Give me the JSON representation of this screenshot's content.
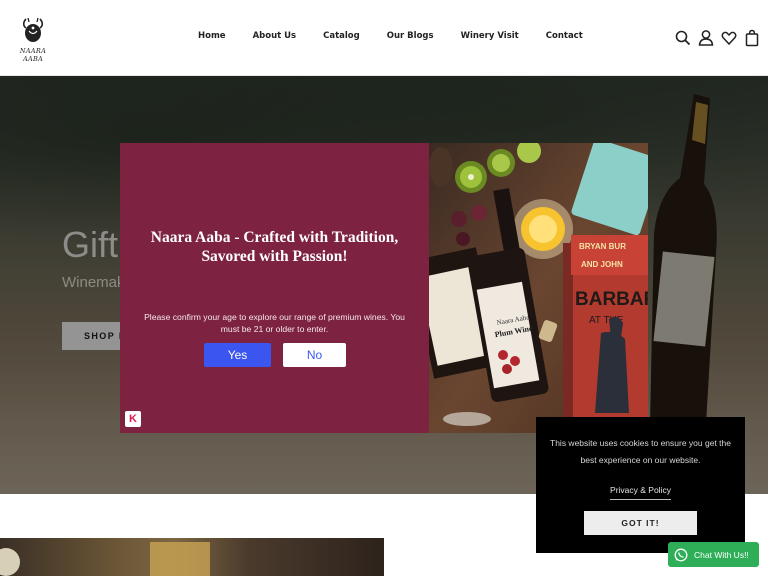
{
  "brand": {
    "name": "NAARA AABA"
  },
  "nav": {
    "items": [
      {
        "label": "Home"
      },
      {
        "label": "About Us"
      },
      {
        "label": "Catalog"
      },
      {
        "label": "Our Blogs"
      },
      {
        "label": "Winery Visit"
      },
      {
        "label": "Contact"
      }
    ]
  },
  "header_icons": [
    "search-icon",
    "account-icon",
    "wishlist-heart-icon",
    "cart-bag-icon"
  ],
  "hero": {
    "title": "Gift",
    "subtitle": "Winemak",
    "button_label": "SHOP N"
  },
  "age_gate": {
    "title": "Naara Aaba - Crafted with Tradition, Savored with Passion!",
    "message": "Please confirm your age to explore our range of premium wines. You must be 21 or older to enter.",
    "yes_label": "Yes",
    "no_label": "No",
    "badge": "K",
    "colors": {
      "panel": "#7d2341",
      "yes": "#3b55f0"
    },
    "image": {
      "bottle_label": "Plum Wine",
      "bottle_label_sub": "Naara Aaba",
      "book_author": "BRYAN BUR",
      "book_author_2": "AND JOHN",
      "book_title": "BARBAR",
      "book_title_2": "AT THE"
    }
  },
  "cookie_banner": {
    "message": "This website uses cookies to ensure you get the best experience on our website.",
    "link_label": "Privacy & Policy",
    "button_label": "GOT IT!"
  },
  "chat": {
    "label": "Chat With Us!!",
    "color": "#2dae57"
  }
}
